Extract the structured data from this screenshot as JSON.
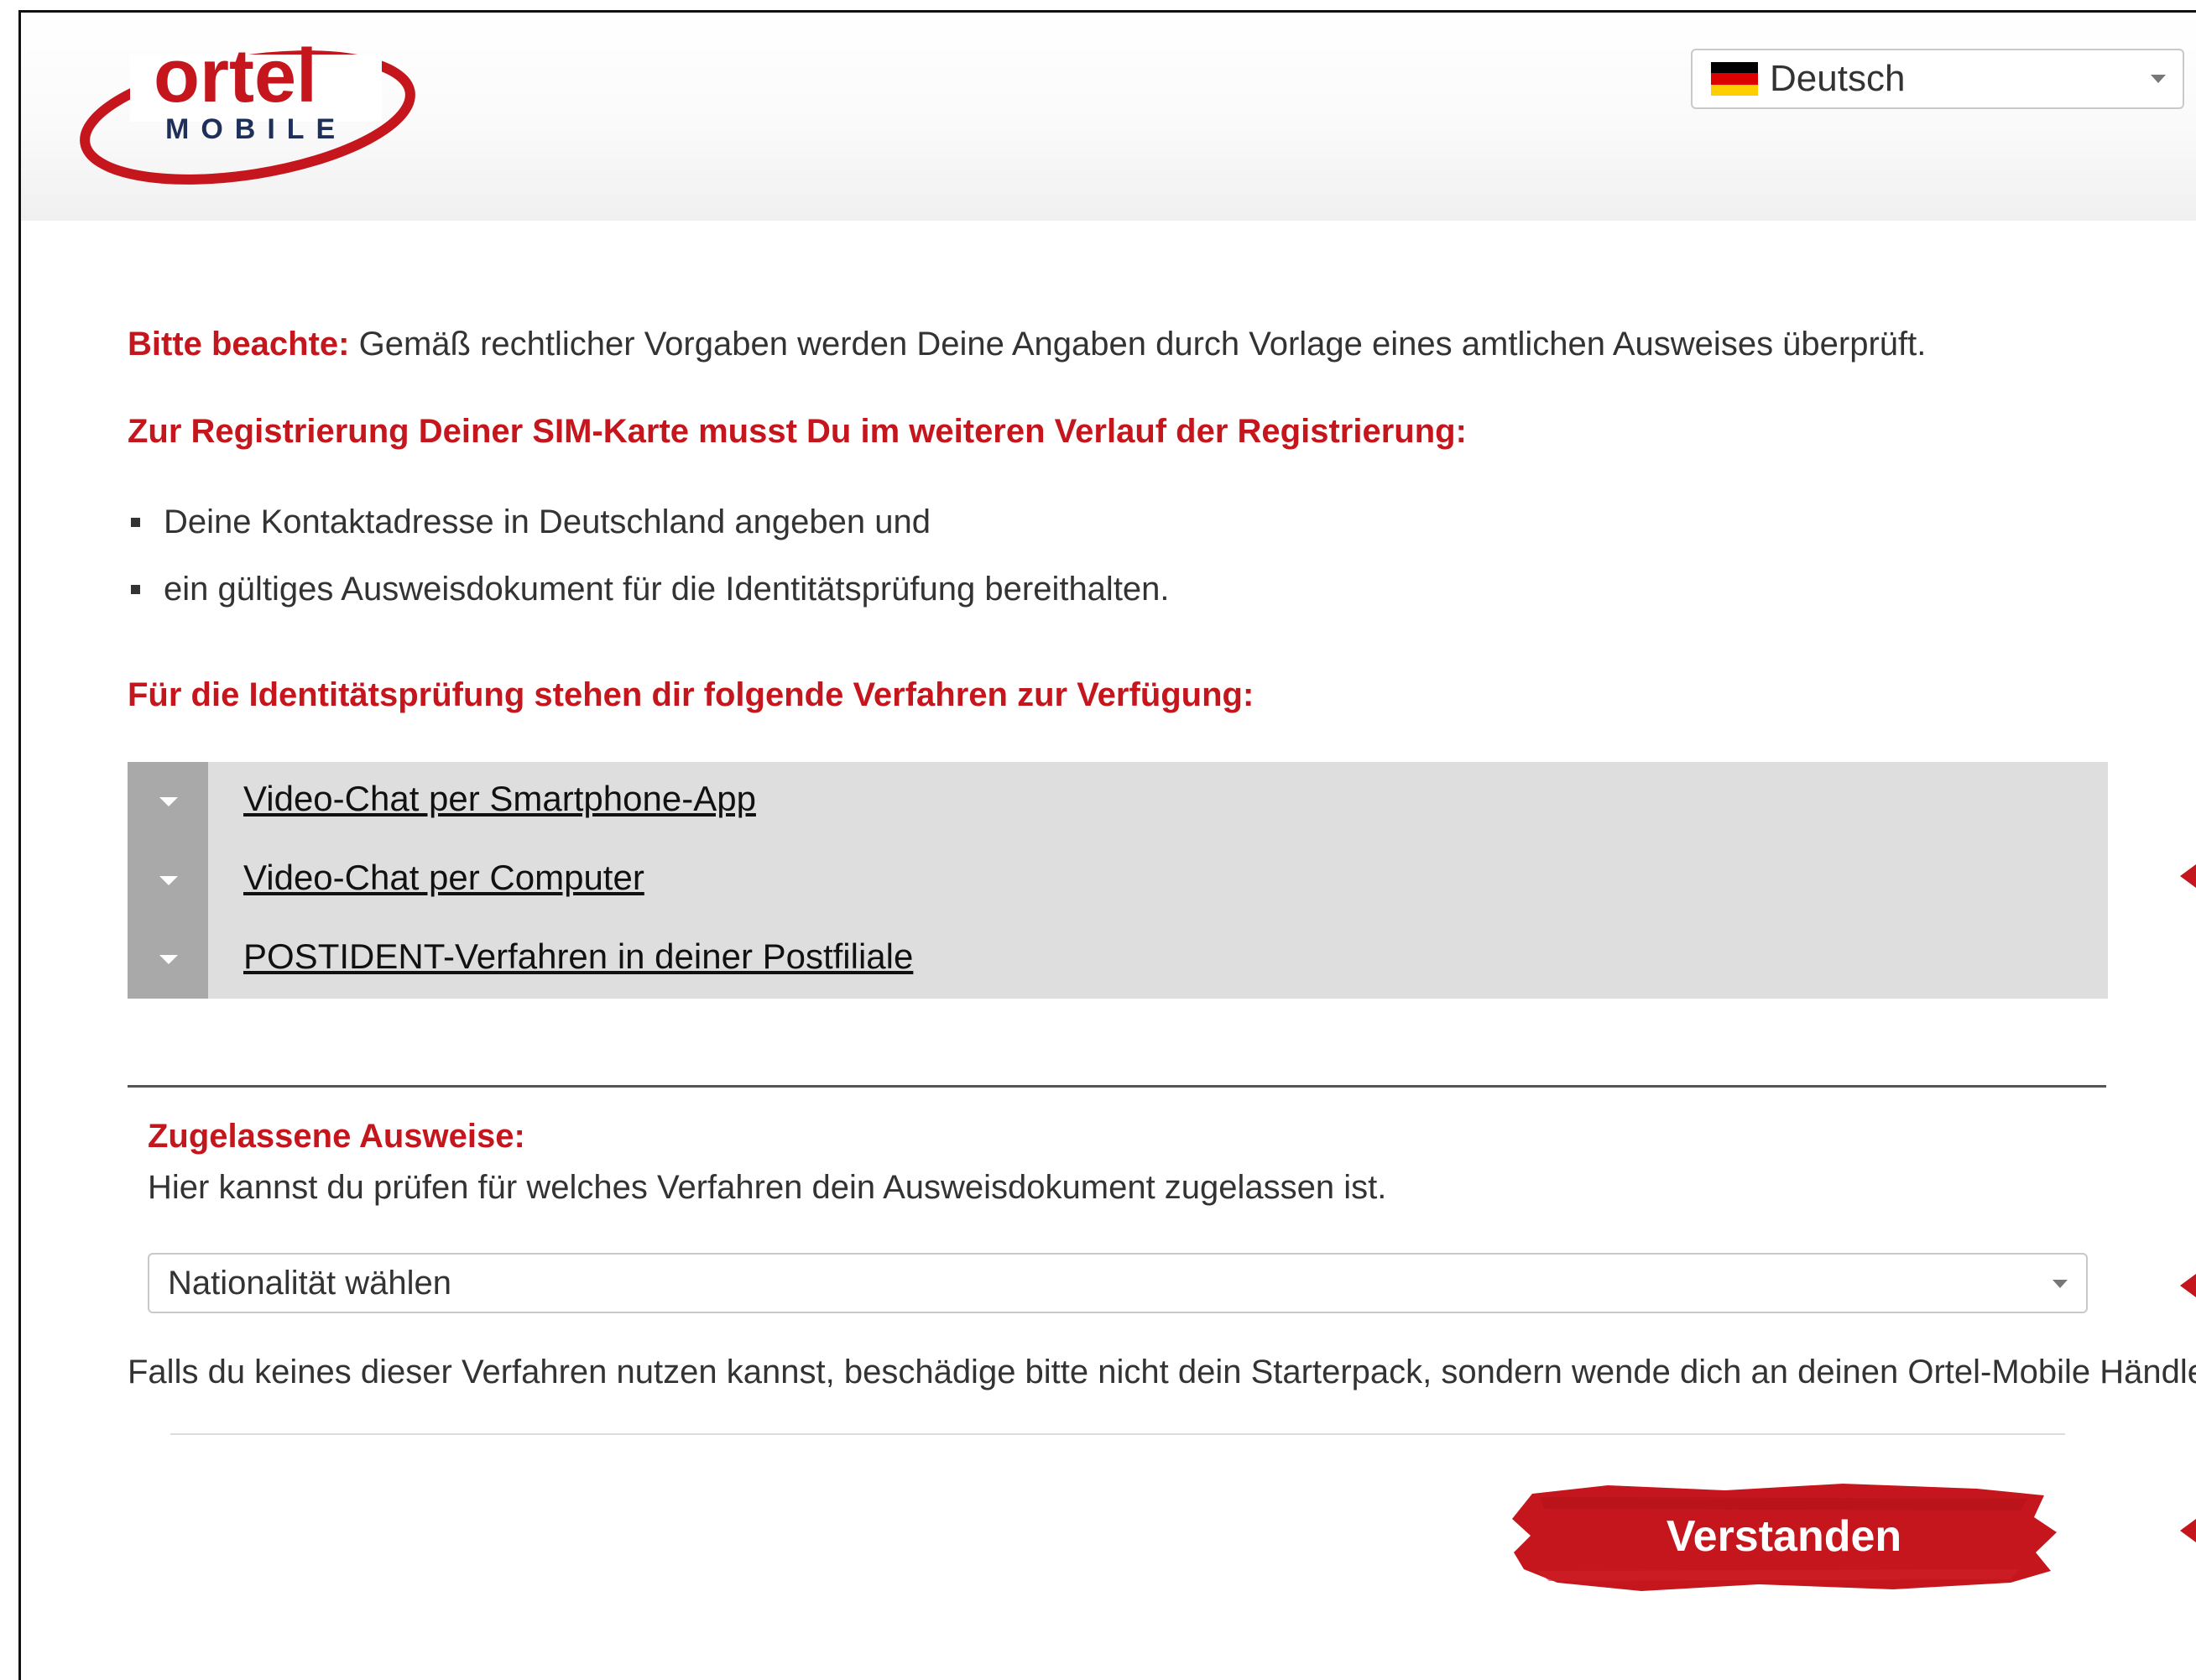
{
  "header": {
    "logo_word": "ortel",
    "logo_sub": "MOBILE",
    "language": {
      "selected": "Deutsch"
    }
  },
  "notice": {
    "lead": "Bitte beachte:",
    "text": " Gemäß rechtlicher Vorgaben werden Deine Angaben durch Vorlage eines amtlichen Ausweises überprüft."
  },
  "registration": {
    "heading": "Zur Registrierung Deiner SIM-Karte musst Du im weiteren Verlauf der Registrierung:",
    "items": [
      "Deine Kontaktadresse in Deutschland angeben und",
      "ein gültiges Ausweisdokument für die Identitätsprüfung bereithalten."
    ]
  },
  "procedures": {
    "heading": "Für die Identitätsprüfung stehen dir folgende Verfahren zur Verfügung:",
    "items": [
      "Video-Chat per Smartphone-App",
      "Video-Chat per Computer",
      "POSTIDENT-Verfahren in deiner Postfiliale"
    ]
  },
  "ids": {
    "heading": "Zugelassene Ausweise:",
    "text": "Hier kannst du prüfen für welches Verfahren dein Ausweisdokument zugelassen ist.",
    "select_placeholder": "Nationalität wählen"
  },
  "note": "Falls du keines dieser Verfahren nutzen kannst, beschädige bitte nicht dein Starterpack, sondern wende dich an deinen Ortel-Mobile Händler.",
  "button": {
    "label": "Verstanden"
  },
  "colors": {
    "brand_red": "#c4161c",
    "accordion_bg": "#dedede",
    "accordion_side": "#a9a9a9"
  }
}
